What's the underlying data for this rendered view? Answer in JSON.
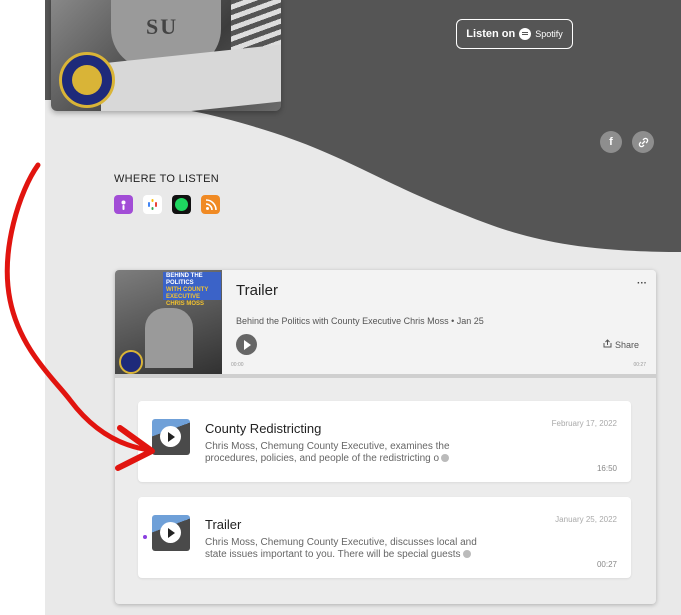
{
  "hero": {
    "listen_prefix": "Listen on",
    "spotify_word": "Spotify",
    "seal_text": "CHEMUNG COUNTY N.Y. EXECUTIVE",
    "cover_sweat_text": "SU",
    "social_icons": [
      "facebook-icon",
      "link-icon"
    ],
    "colors": {
      "band": "#555555",
      "background": "#e9e9e9"
    }
  },
  "where": {
    "heading": "WHERE TO LISTEN",
    "platforms": [
      "apple-podcasts-icon",
      "google-podcasts-icon",
      "spotify-icon",
      "rss-icon"
    ]
  },
  "player": {
    "title": "Trailer",
    "meta": "Behind the Politics with County Executive Chris Moss • Jan 25",
    "share_label": "Share",
    "time_start": "00:00",
    "time_end": "00:27",
    "art_banner_line1": "BEHIND THE",
    "art_banner_line2": "POLITICS",
    "art_banner_line3": "WITH COUNTY EXECUTIVE CHRIS MOSS",
    "menu_glyph": "···"
  },
  "episodes": [
    {
      "title": "County Redistricting",
      "description": "Chris Moss, Chemung County Executive, examines the procedures, policies, and people of the redistricting o",
      "date": "February 17, 2022",
      "duration": "16:50"
    },
    {
      "title": "Trailer",
      "description": "Chris Moss, Chemung County Executive, discusses local and state issues important to you. There will be special guests",
      "date": "January 25, 2022",
      "duration": "00:27"
    }
  ]
}
